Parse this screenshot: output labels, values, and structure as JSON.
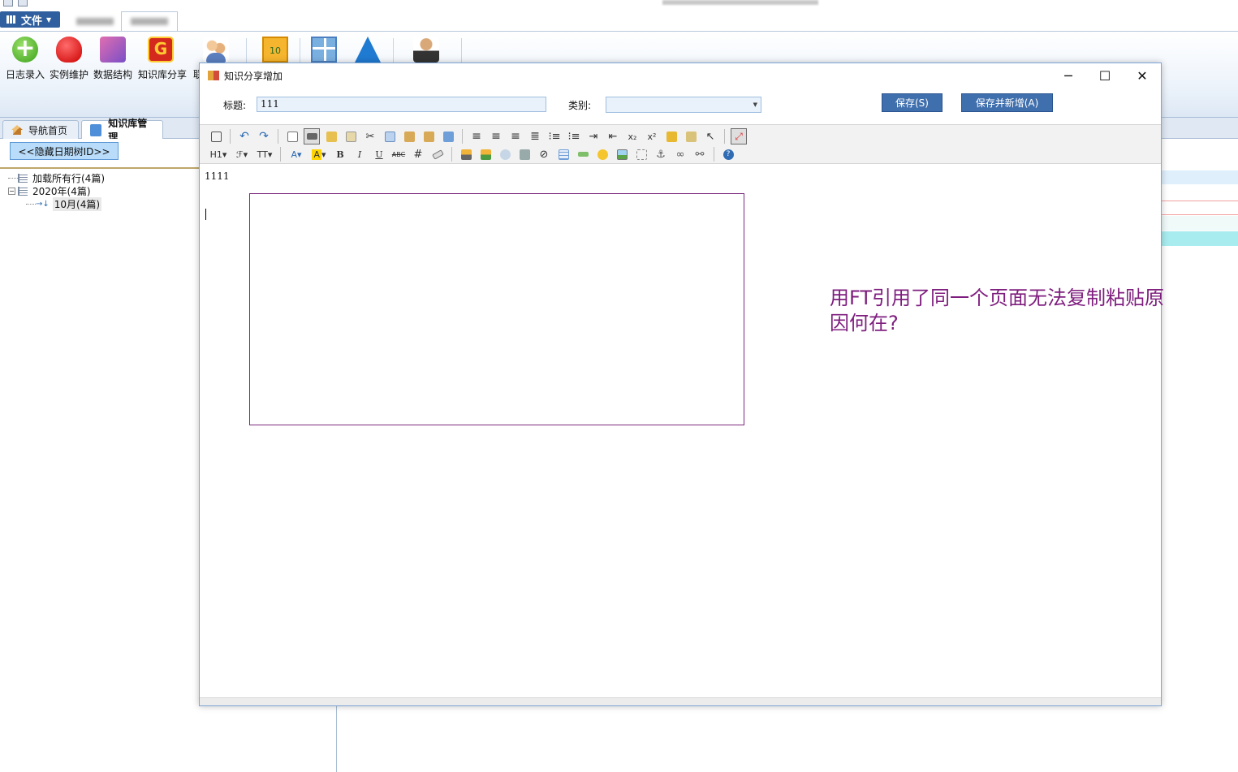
{
  "app": {
    "file_menu": "文件",
    "tabs": [
      "导航首页",
      "知识库管理"
    ]
  },
  "ribbon": {
    "buttons": [
      "日志录入",
      "实例维护",
      "数据结构",
      "知识库分享",
      "联"
    ]
  },
  "left_panel": {
    "hide_tree_button": "<<隐藏日期树ID>>",
    "tree": [
      {
        "label": "加载所有行(4篇)"
      },
      {
        "label": "2020年(4篇)"
      },
      {
        "label": "10月(4篇)"
      }
    ]
  },
  "dialog": {
    "title": "知识分享增加",
    "title_label": "标题:",
    "title_value": "111",
    "category_label": "类别:",
    "category_value": "",
    "save_button": "保存(S)",
    "save_new_button": "保存并新增(A)",
    "toolbar": {
      "heading": "H1",
      "font_family": "ℱ",
      "font_size": "TT",
      "font_color": "A",
      "highlight": "A",
      "bold": "B",
      "italic": "I",
      "underline": "U",
      "strike": "ABC"
    },
    "editor": {
      "text": "1111"
    },
    "annotation": "用FT引用了同一个页面无法复制粘贴原因何在?"
  },
  "colors": {
    "accent": "#2f5f9e",
    "annotation": "#7e1d7e",
    "frame": "#7b2a7e"
  }
}
